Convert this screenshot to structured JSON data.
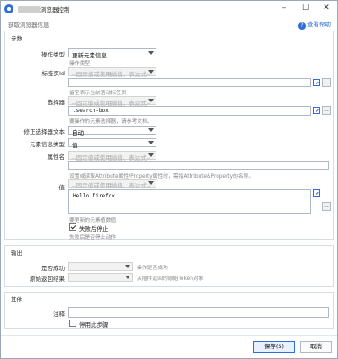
{
  "window": {
    "title_suffix": "浏览器控制",
    "minimize": "–",
    "maximize": "☐",
    "close": "✕"
  },
  "header": {
    "description": "获取浏览器信息",
    "help_label": "查看帮助",
    "help_icon": "?"
  },
  "params": {
    "section_title": "参数",
    "op_type_label": "操作类型",
    "op_type_value": "更新元素信息",
    "op_type_hint": "操作类型",
    "tab_id_label": "标签页Id",
    "tab_id_placeholder": "--固定值或使用插值、表达式--",
    "tab_id_hint": "留空表示当前活动标签页",
    "selector_label": "选择器",
    "selector_placeholder": "--固定值或使用插值、表达式--",
    "selector_value": ".search-box",
    "selector_hint": "要操作的元素选择器，请参考文档。",
    "correct_label": "修正选择器文本",
    "correct_value": "自动",
    "elem_info_label": "元素信息类型",
    "elem_info_value": "值",
    "attr_label": "属性名",
    "attr_placeholder": "--固定值或使用插值、表达式--",
    "attr_hint": "设置或读取Attribute属性/Property属性时，需指Attribute&Property的名称。",
    "value_label": "值",
    "value_placeholder": "--固定值或使用插值、表达式--",
    "value_text": "Hello firefox",
    "value_hint": "要更新的元素值数值",
    "stop_on_fail_label": "失败后停止",
    "stop_on_fail_hint": "失败后是否停止动作",
    "more_button": "..."
  },
  "output": {
    "section_title": "输出",
    "success_label": "是否成功",
    "success_hint": "操作是否成功",
    "token_label": "原始返回结果",
    "token_hint": "从插件返回的原始Token对象"
  },
  "other": {
    "section_title": "其他",
    "note_label": "注释",
    "disable_label": "停用此步骤"
  },
  "footer": {
    "save_label": "保存(S)",
    "cancel_label": "取消"
  },
  "colors": {
    "accent": "#2f6fd6"
  }
}
